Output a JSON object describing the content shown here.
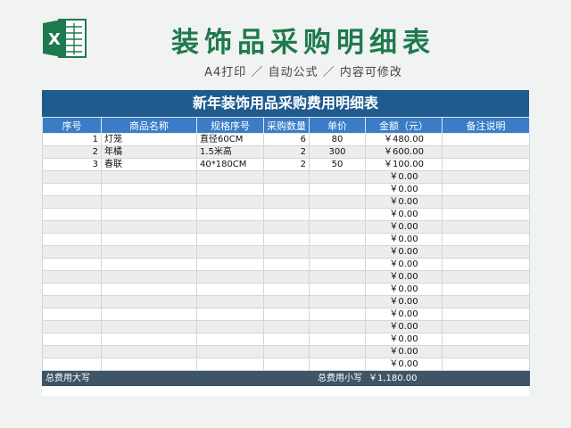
{
  "header": {
    "title": "装饰品采购明细表",
    "subtitle": "A4打印 ／ 自动公式 ／ 内容可修改"
  },
  "sheet": {
    "title": "新年装饰用品采购费用明细表",
    "columns": [
      "序号",
      "商品名称",
      "规格序号",
      "采购数量",
      "单价",
      "金额（元）",
      "备注说明"
    ],
    "rows": [
      {
        "no": "1",
        "name": "灯笼",
        "spec": "直径60CM",
        "qty": "6",
        "price": "80",
        "amount": "￥480.00",
        "note": ""
      },
      {
        "no": "2",
        "name": "年橘",
        "spec": "1.5米高",
        "qty": "2",
        "price": "300",
        "amount": "￥600.00",
        "note": ""
      },
      {
        "no": "3",
        "name": "春联",
        "spec": "40*180CM",
        "qty": "2",
        "price": "50",
        "amount": "￥100.00",
        "note": ""
      },
      {
        "no": "",
        "name": "",
        "spec": "",
        "qty": "",
        "price": "",
        "amount": "￥0.00",
        "note": ""
      },
      {
        "no": "",
        "name": "",
        "spec": "",
        "qty": "",
        "price": "",
        "amount": "￥0.00",
        "note": ""
      },
      {
        "no": "",
        "name": "",
        "spec": "",
        "qty": "",
        "price": "",
        "amount": "￥0.00",
        "note": ""
      },
      {
        "no": "",
        "name": "",
        "spec": "",
        "qty": "",
        "price": "",
        "amount": "￥0.00",
        "note": ""
      },
      {
        "no": "",
        "name": "",
        "spec": "",
        "qty": "",
        "price": "",
        "amount": "￥0.00",
        "note": ""
      },
      {
        "no": "",
        "name": "",
        "spec": "",
        "qty": "",
        "price": "",
        "amount": "￥0.00",
        "note": ""
      },
      {
        "no": "",
        "name": "",
        "spec": "",
        "qty": "",
        "price": "",
        "amount": "￥0.00",
        "note": ""
      },
      {
        "no": "",
        "name": "",
        "spec": "",
        "qty": "",
        "price": "",
        "amount": "￥0.00",
        "note": ""
      },
      {
        "no": "",
        "name": "",
        "spec": "",
        "qty": "",
        "price": "",
        "amount": "￥0.00",
        "note": ""
      },
      {
        "no": "",
        "name": "",
        "spec": "",
        "qty": "",
        "price": "",
        "amount": "￥0.00",
        "note": ""
      },
      {
        "no": "",
        "name": "",
        "spec": "",
        "qty": "",
        "price": "",
        "amount": "￥0.00",
        "note": ""
      },
      {
        "no": "",
        "name": "",
        "spec": "",
        "qty": "",
        "price": "",
        "amount": "￥0.00",
        "note": ""
      },
      {
        "no": "",
        "name": "",
        "spec": "",
        "qty": "",
        "price": "",
        "amount": "￥0.00",
        "note": ""
      },
      {
        "no": "",
        "name": "",
        "spec": "",
        "qty": "",
        "price": "",
        "amount": "￥0.00",
        "note": ""
      },
      {
        "no": "",
        "name": "",
        "spec": "",
        "qty": "",
        "price": "",
        "amount": "￥0.00",
        "note": ""
      },
      {
        "no": "",
        "name": "",
        "spec": "",
        "qty": "",
        "price": "",
        "amount": "￥0.00",
        "note": ""
      }
    ],
    "footer": {
      "total_upper_label": "总费用大写",
      "total_lower_label": "总费用小写",
      "total_lower_value": "￥1,180.00"
    }
  },
  "icons": {
    "logo": "excel-icon"
  },
  "colors": {
    "title_green": "#1e7a4c",
    "banner_blue": "#1f5b8e",
    "header_blue": "#3a7cc6",
    "footer_slate": "#3f5566"
  }
}
